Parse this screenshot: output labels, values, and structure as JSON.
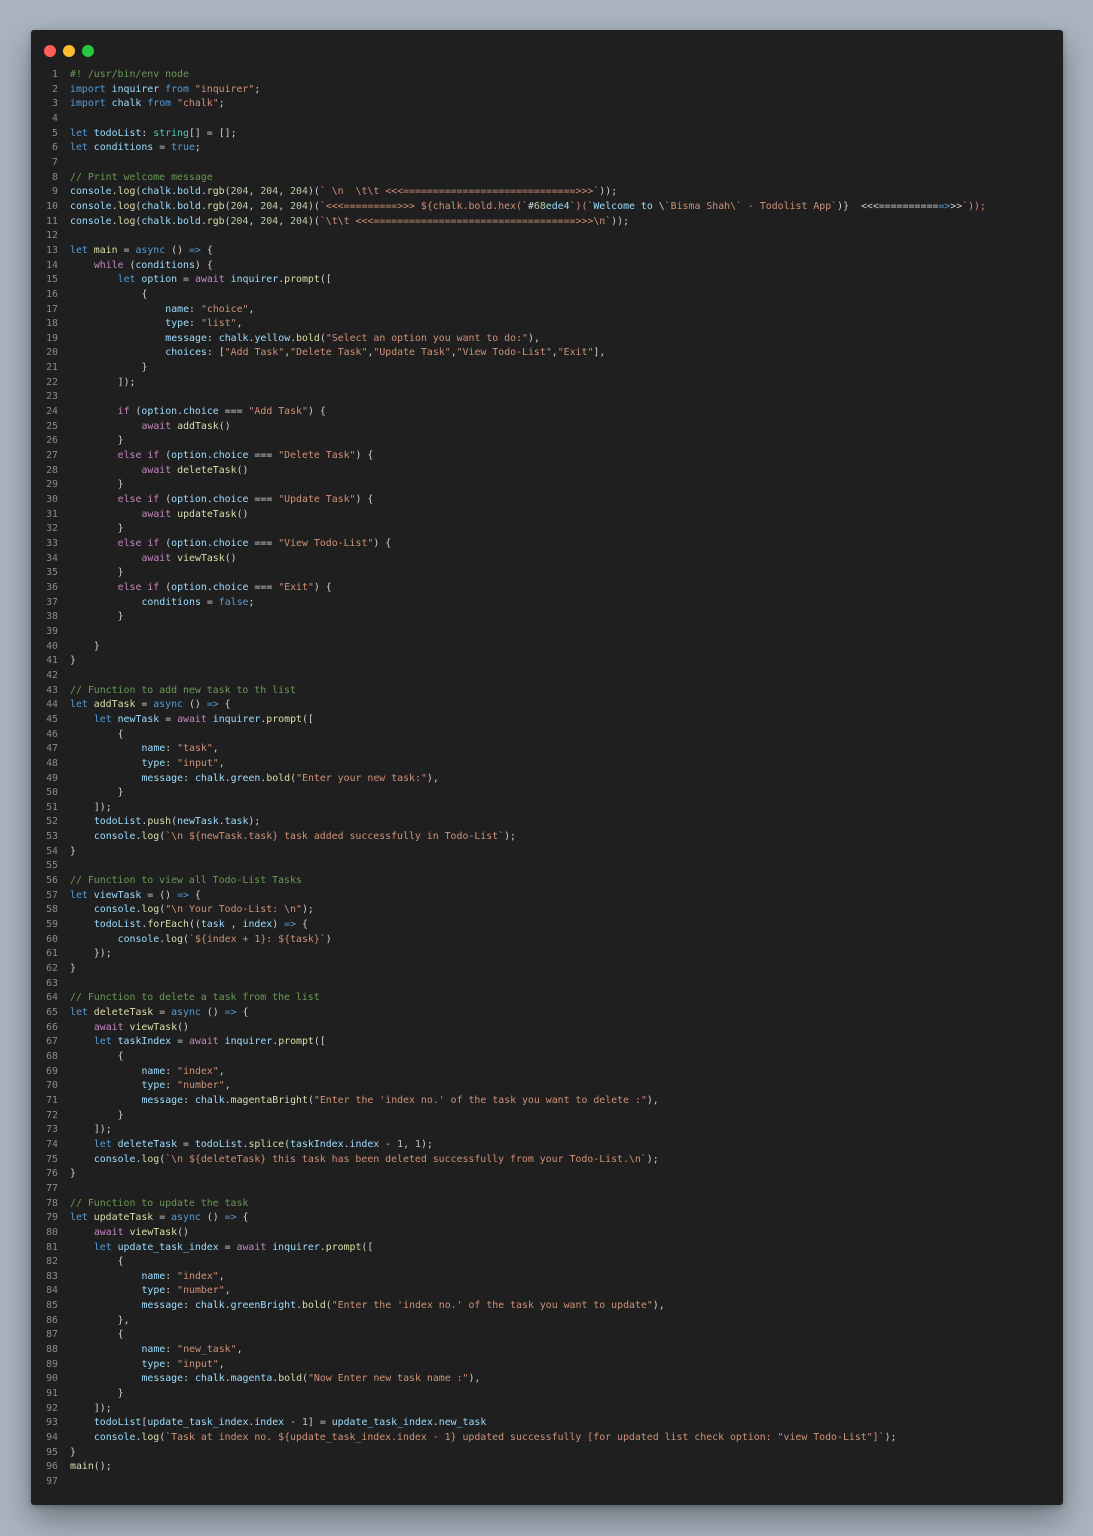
{
  "window": {
    "dots": [
      {
        "name": "close-dot",
        "color": "#ff5f57"
      },
      {
        "name": "minimize-dot",
        "color": "#febc2e"
      },
      {
        "name": "maximize-dot",
        "color": "#28c840"
      }
    ]
  },
  "code": {
    "lines": [
      "#! /usr/bin/env node",
      "import inquirer from \"inquirer\";",
      "import chalk from \"chalk\";",
      "",
      "let todoList: string[] = [];",
      "let conditions = true;",
      "",
      "// Print welcome message",
      "console.log(chalk.bold.rgb(204, 204, 204)(` \\n  \\t\\t <<<=============================>>>`));",
      "console.log(chalk.bold.rgb(204, 204, 204)(`<<<=========>>> ${chalk.bold.hex(`#68ede4`)(`Welcome to \\`Bisma Shah\\` - Todolist App`)}  <<<===========>>>`));",
      "console.log(chalk.bold.rgb(204, 204, 204)(`\\t\\t <<<==================================>>>\\n`));",
      "",
      "let main = async () => {",
      "    while (conditions) {",
      "        let option = await inquirer.prompt([",
      "            {",
      "                name: \"choice\",",
      "                type: \"list\",",
      "                message: chalk.yellow.bold(\"Select an option you want to do:\"),",
      "                choices: [\"Add Task\",\"Delete Task\",\"Update Task\",\"View Todo-List\",\"Exit\"],",
      "            }",
      "        ]);",
      "",
      "        if (option.choice === \"Add Task\") {",
      "            await addTask()",
      "        }",
      "        else if (option.choice === \"Delete Task\") {",
      "            await deleteTask()",
      "        }",
      "        else if (option.choice === \"Update Task\") {",
      "            await updateTask()",
      "        }",
      "        else if (option.choice === \"View Todo-List\") {",
      "            await viewTask()",
      "        }",
      "        else if (option.choice === \"Exit\") {",
      "            conditions = false;",
      "        }",
      "",
      "    }",
      "}",
      "",
      "// Function to add new task to th list",
      "let addTask = async () => {",
      "    let newTask = await inquirer.prompt([",
      "        {",
      "            name: \"task\",",
      "            type: \"input\",",
      "            message: chalk.green.bold(\"Enter your new task:\"),",
      "        }",
      "    ]);",
      "    todoList.push(newTask.task);",
      "    console.log(`\\n ${newTask.task} task added successfully in Todo-List`);",
      "}",
      "",
      "// Function to view all Todo-List Tasks",
      "let viewTask = () => {",
      "    console.log(\"\\n Your Todo-List: \\n\");",
      "    todoList.forEach((task , index) => {",
      "        console.log(`${index + 1}: ${task}`)",
      "    });",
      "}",
      "",
      "// Function to delete a task from the list",
      "let deleteTask = async () => {",
      "    await viewTask()",
      "    let taskIndex = await inquirer.prompt([",
      "        {",
      "            name: \"index\",",
      "            type: \"number\",",
      "            message: chalk.magentaBright(\"Enter the 'index no.' of the task you want to delete :\"),",
      "        }",
      "    ]);",
      "    let deleteTask = todoList.splice(taskIndex.index - 1, 1);",
      "    console.log(`\\n ${deleteTask} this task has been deleted successfully from your Todo-List.\\n`);",
      "}",
      "",
      "// Function to update the task",
      "let updateTask = async () => {",
      "    await viewTask()",
      "    let update_task_index = await inquirer.prompt([",
      "        {",
      "            name: \"index\",",
      "            type: \"number\",",
      "            message: chalk.greenBright.bold(\"Enter the 'index no.' of the task you want to update\"),",
      "        },",
      "        {",
      "            name: \"new_task\",",
      "            type: \"input\",",
      "            message: chalk.magenta.bold(\"Now Enter new task name :\"),",
      "        }",
      "    ]);",
      "    todoList[update_task_index.index - 1] = update_task_index.new_task",
      "    console.log(`Task at index no. ${update_task_index.index - 1} updated successfully [for updated list check option: \"view Todo-List\"]`);",
      "}",
      "main();",
      ""
    ]
  }
}
